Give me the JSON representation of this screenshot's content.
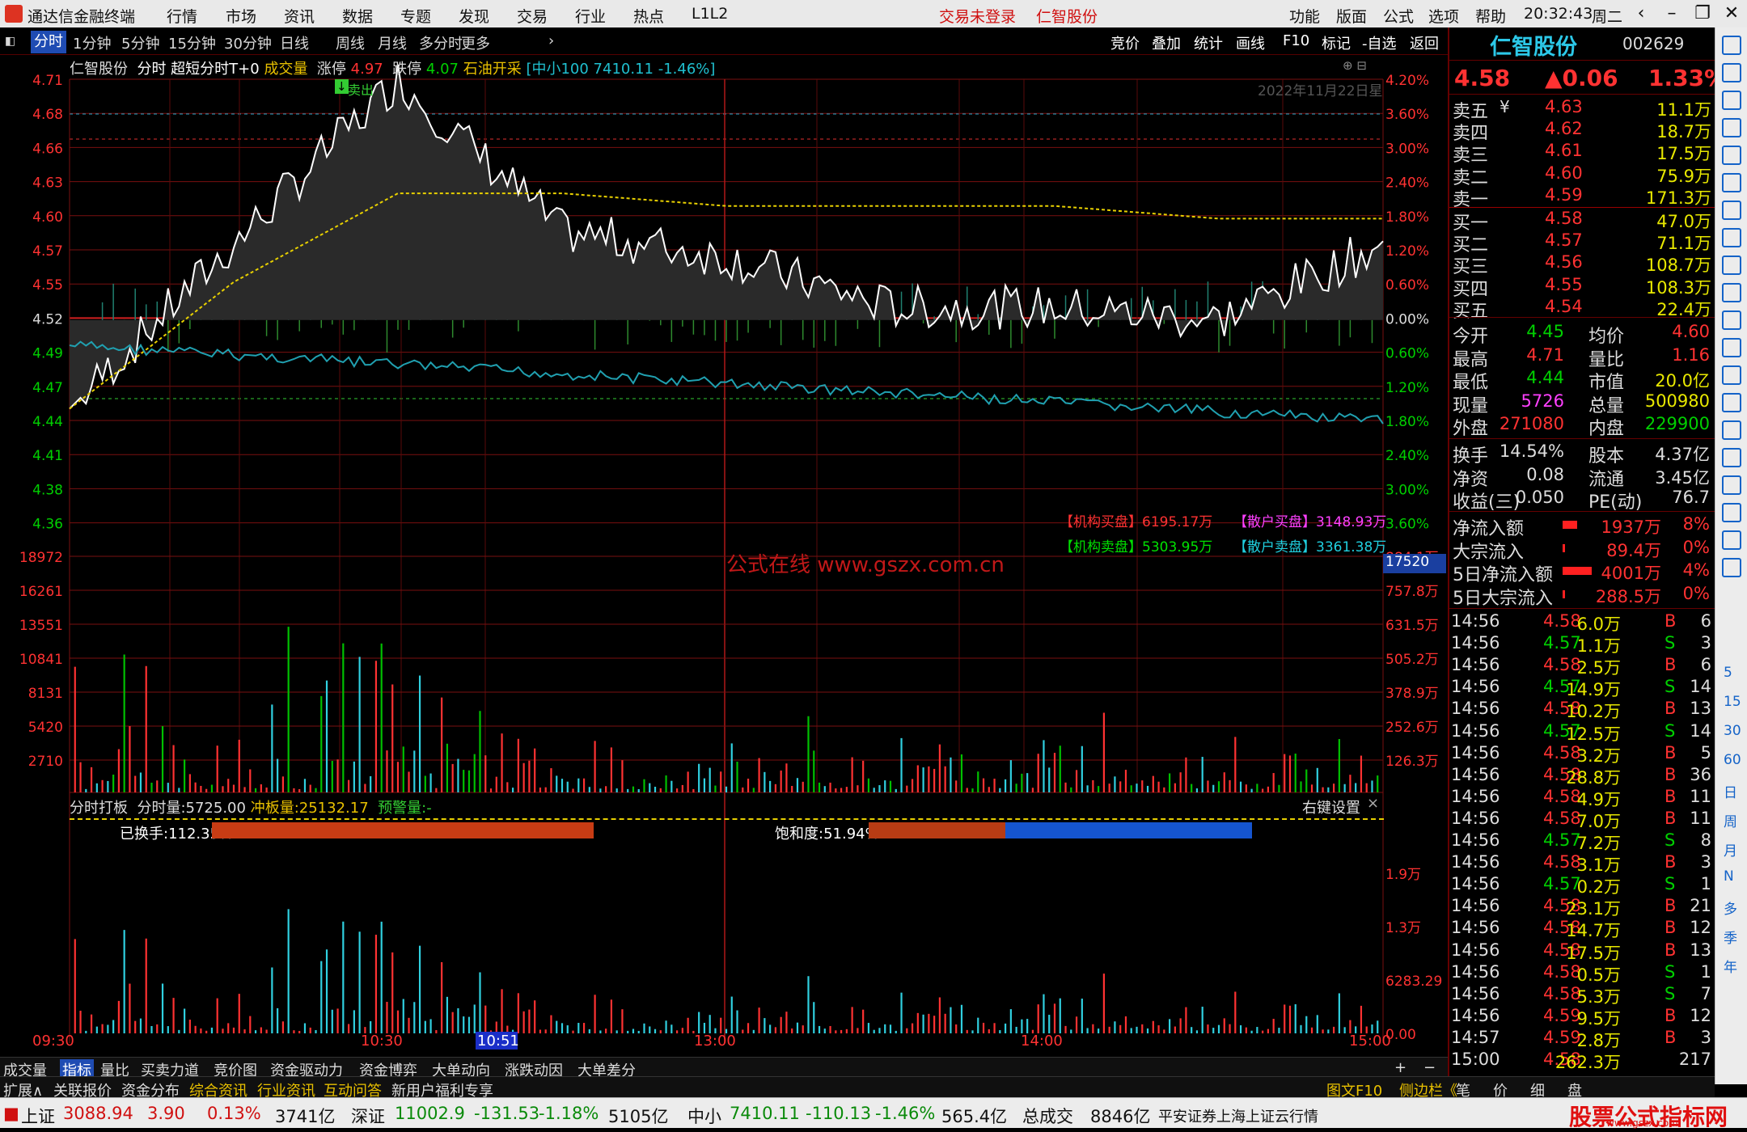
{
  "app": {
    "title": "通达信金融终端",
    "menus": [
      "行情",
      "市场",
      "资讯",
      "数据",
      "专题",
      "发现",
      "交易",
      "行业",
      "热点",
      "L1L2"
    ],
    "center": [
      "交易未登录",
      "仁智股份"
    ],
    "right_menus": [
      "功能",
      "版面",
      "公式",
      "选项",
      "帮助"
    ],
    "time": "20:32:43",
    "weekday": "周二"
  },
  "tabs": [
    "分时",
    "1分钟",
    "5分钟",
    "15分钟",
    "30分钟",
    "日线",
    "周线",
    "月线",
    "多分时",
    "更多"
  ],
  "toolbar": [
    "竞价",
    "叠加",
    "统计",
    "画线",
    "F10",
    "标记",
    "-自选",
    "返回"
  ],
  "header": {
    "name": "仁智股份",
    "mode": "分时 超短分时T+0",
    "vol_label": "成交量",
    "limit_up_label": "涨停",
    "limit_up": "4.97",
    "limit_down_label": "跌停",
    "limit_down": "4.07",
    "concept": "石油开采",
    "index_info": "[中小100 7410.11 -1.46%]",
    "date": "2022年11月22日星",
    "sell_tag": "卖出"
  },
  "price_axis_left": [
    "4.71",
    "4.68",
    "4.66",
    "4.63",
    "4.60",
    "4.57",
    "4.55",
    "4.52",
    "4.49",
    "4.47",
    "4.44",
    "4.41",
    "4.38",
    "4.36"
  ],
  "price_axis_right": [
    "4.20%",
    "3.60%",
    "3.00%",
    "2.40%",
    "1.80%",
    "1.20%",
    "0.60%",
    "0.00%",
    "0.60%",
    "1.20%",
    "1.80%",
    "2.40%",
    "3.00%",
    "3.60%"
  ],
  "vol_axis_left": [
    "18972",
    "16261",
    "13551",
    "10841",
    "8131",
    "5420",
    "2710"
  ],
  "vol_axis_right": [
    "884.1万",
    "757.8万",
    "631.5万",
    "505.2万",
    "378.9万",
    "252.6万",
    "126.3万"
  ],
  "vol_highlight": "17520",
  "inst": {
    "buy_label": "【机构买盘】",
    "buy": "6195.17万",
    "retail_buy_label": "【散户买盘】",
    "retail_buy": "3148.93万",
    "sell_label": "【机构卖盘】",
    "sell": "5303.95万",
    "retail_sell_label": "【散户卖盘】",
    "retail_sell": "3361.38万"
  },
  "watermark": "公式在线 www.gszx.com.cn",
  "panel2": {
    "title": "分时打板",
    "fvol_label": "分时量:",
    "fvol": "5725.00",
    "cb_label": "冲板量:",
    "cb": "25132.17",
    "warn_label": "预警量:",
    "warn": "-",
    "settings": "右键设置",
    "close": "×",
    "turnover": "已换手:112.35%",
    "saturation": "饱和度:51.94%",
    "axis": [
      "1.9万",
      "1.3万",
      "6283.29",
      "0.00"
    ],
    "turnover_frac": 0.4,
    "sat_fill": 0.51
  },
  "time_axis": [
    "09:30",
    "10:30",
    "10:51",
    "13:00",
    "14:00",
    "15:00"
  ],
  "chart_data": {
    "type": "line",
    "x": [
      "09:30",
      "10:00",
      "10:30",
      "11:00",
      "11:30/13:00",
      "13:30",
      "14:00",
      "14:30",
      "15:00"
    ],
    "series": [
      {
        "name": "价格",
        "values": [
          4.45,
          4.58,
          4.71,
          4.59,
          4.57,
          4.53,
          4.53,
          4.52,
          4.58
        ]
      },
      {
        "name": "均价",
        "values": [
          4.45,
          4.55,
          4.62,
          4.62,
          4.61,
          4.61,
          4.61,
          4.6,
          4.6
        ]
      }
    ],
    "ylim": [
      4.33,
      4.71
    ],
    "prev_close": 4.52
  },
  "quote": {
    "name": "仁智股份",
    "code": "002629",
    "price": "4.58",
    "change": "▲0.06",
    "pct": "1.33%"
  },
  "orderbook": [
    {
      "l": "卖五",
      "p": "4.63",
      "v": "11.1万",
      "t": "s"
    },
    {
      "l": "卖四",
      "p": "4.62",
      "v": "18.7万",
      "t": "s"
    },
    {
      "l": "卖三",
      "p": "4.61",
      "v": "17.5万",
      "t": "s"
    },
    {
      "l": "卖二",
      "p": "4.60",
      "v": "75.9万",
      "t": "s"
    },
    {
      "l": "卖一",
      "p": "4.59",
      "v": "171.3万",
      "t": "s"
    },
    {
      "l": "买一",
      "p": "4.58",
      "v": "47.0万",
      "t": "b"
    },
    {
      "l": "买二",
      "p": "4.57",
      "v": "71.1万",
      "t": "b"
    },
    {
      "l": "买三",
      "p": "4.56",
      "v": "108.7万",
      "t": "b"
    },
    {
      "l": "买四",
      "p": "4.55",
      "v": "108.3万",
      "t": "b"
    },
    {
      "l": "买五",
      "p": "4.54",
      "v": "22.4万",
      "t": "b"
    }
  ],
  "yen": "¥",
  "stats": [
    [
      "今开",
      "4.45",
      "均价",
      "4.60"
    ],
    [
      "最高",
      "4.71",
      "量比",
      "1.16"
    ],
    [
      "最低",
      "4.44",
      "市值",
      "20.0亿"
    ],
    [
      "现量",
      "5726",
      "总量",
      "500980"
    ],
    [
      "外盘",
      "271080",
      "内盘",
      "229900"
    ]
  ],
  "stats2": [
    [
      "换手",
      "14.54%",
      "股本",
      "4.37亿"
    ],
    [
      "净资",
      "0.08",
      "流通",
      "3.45亿"
    ],
    [
      "收益(三)",
      "0.050",
      "PE(动)",
      "76.7"
    ]
  ],
  "flow": [
    [
      "净流入额",
      "1937万",
      "8%"
    ],
    [
      "大宗流入",
      "89.4万",
      "0%"
    ],
    [
      "5日净流入额",
      "4001万",
      "4%"
    ],
    [
      "5日大宗流入",
      "288.5万",
      "0%"
    ]
  ],
  "ticks": [
    [
      "14:56",
      "4.58",
      "6.0万",
      "B",
      "6"
    ],
    [
      "14:56",
      "4.57",
      "1.1万",
      "S",
      "3"
    ],
    [
      "14:56",
      "4.58",
      "2.5万",
      "B",
      "6"
    ],
    [
      "14:56",
      "4.57",
      "14.9万",
      "S",
      "14"
    ],
    [
      "14:56",
      "4.58",
      "10.2万",
      "B",
      "13"
    ],
    [
      "14:56",
      "4.57",
      "12.5万",
      "S",
      "14"
    ],
    [
      "14:56",
      "4.58",
      "3.2万",
      "B",
      "5"
    ],
    [
      "14:56",
      "4.58",
      "28.8万",
      "B",
      "36"
    ],
    [
      "14:56",
      "4.58",
      "4.9万",
      "B",
      "11"
    ],
    [
      "14:56",
      "4.58",
      "7.0万",
      "B",
      "11"
    ],
    [
      "14:56",
      "4.57",
      "7.2万",
      "S",
      "8"
    ],
    [
      "14:56",
      "4.58",
      "3.1万",
      "B",
      "3"
    ],
    [
      "14:56",
      "4.57",
      "0.2万",
      "S",
      "1"
    ],
    [
      "14:56",
      "4.58",
      "23.1万",
      "B",
      "21"
    ],
    [
      "14:56",
      "4.58",
      "14.7万",
      "B",
      "12"
    ],
    [
      "14:56",
      "4.58",
      "17.5万",
      "B",
      "13"
    ],
    [
      "14:56",
      "4.58",
      "0.5万",
      "S",
      "1"
    ],
    [
      "14:56",
      "4.58",
      "5.3万",
      "S",
      "7"
    ],
    [
      "14:56",
      "4.59",
      "9.5万",
      "B",
      "12"
    ],
    [
      "14:57",
      "4.59",
      "2.8万",
      "B",
      "3"
    ],
    [
      "15:00",
      "4.58",
      "262.3万",
      "",
      "217"
    ]
  ],
  "sidetext": [
    "5",
    "15",
    "30",
    "60",
    "日",
    "周",
    "月",
    "N",
    "多",
    "季",
    "年"
  ],
  "bottom_tabs": [
    "成交量",
    "指标",
    "量比",
    "买卖力道",
    "竞价图",
    "资金驱动力",
    "资金博弈",
    "大单动向",
    "涨跌动因",
    "大单差分"
  ],
  "bottom_tabs2": [
    "扩展∧",
    "关联报价",
    "资金分布",
    "综合资讯",
    "行业资讯",
    "互动问答",
    "新用户福利专享"
  ],
  "bottom_right": [
    "图文F10",
    "侧边栏《",
    "笔",
    "价",
    "细",
    "盘"
  ],
  "status": {
    "sh_label": "上证",
    "sh": "3088.94",
    "sh_chg": "3.90",
    "sh_pct": "0.13%",
    "sh_amt": "3741亿",
    "sz_label": "深证",
    "sz": "11002.9",
    "sz_chg": "-131.53",
    "sz_pct": "-1.18%",
    "sz_amt": "5105亿",
    "zx_label": "中小",
    "zx": "7410.11",
    "zx_chg": "-110.13",
    "zx_pct": "-1.46%",
    "zx_amt": "565.4亿",
    "total_label": "总成交",
    "total": "8846亿",
    "broker": "平安证券上海上证云行情",
    "brand": "股票公式指标网",
    "brand_url": "www.gszx.com"
  }
}
